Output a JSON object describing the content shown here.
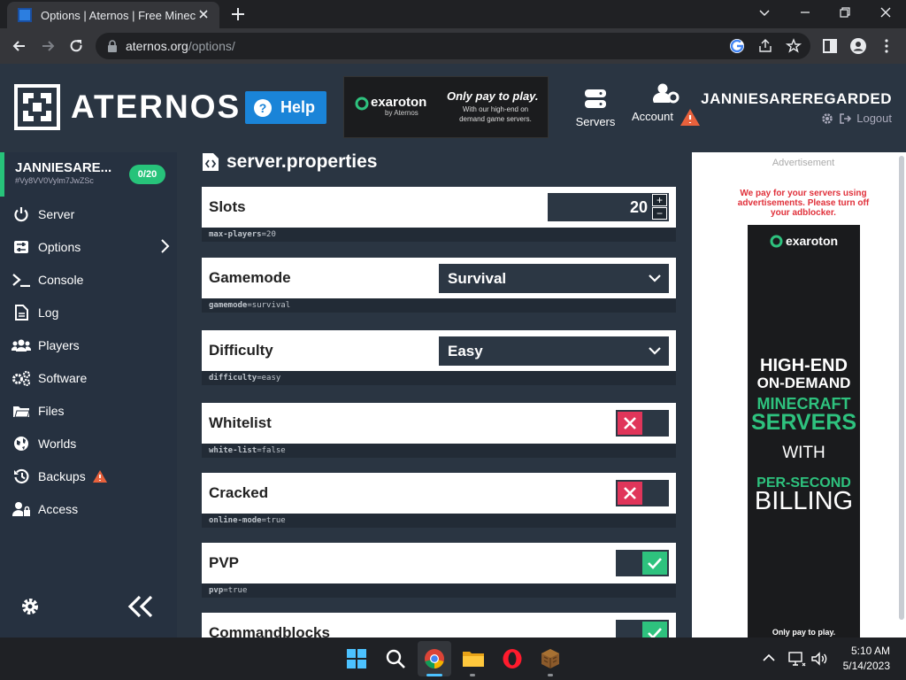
{
  "browser": {
    "tab_title": "Options | Aternos | Free Minecraft",
    "url_host": "aternos.org",
    "url_path": "/options/"
  },
  "header": {
    "brand": "ATERNOS",
    "help_label": "Help",
    "ad": {
      "logo_text": "exaroton",
      "logo_sub": "by Aternos",
      "headline": "Only pay to play.",
      "subline": "With our high-end on demand game servers."
    },
    "servers_label": "Servers",
    "account_label": "Account",
    "username": "JANNIESAREREGARDED",
    "logout_label": "Logout"
  },
  "sidebar": {
    "server_name": "JANNIESARE...",
    "server_id": "#Vy8VV0Vylm7JwZSc",
    "player_count": "0/20",
    "items": [
      {
        "label": "Server",
        "icon": "power-icon"
      },
      {
        "label": "Options",
        "icon": "sliders-icon"
      },
      {
        "label": "Console",
        "icon": "terminal-icon"
      },
      {
        "label": "Log",
        "icon": "file-icon"
      },
      {
        "label": "Players",
        "icon": "users-icon"
      },
      {
        "label": "Software",
        "icon": "gears-icon"
      },
      {
        "label": "Files",
        "icon": "folder-icon"
      },
      {
        "label": "Worlds",
        "icon": "globe-icon"
      },
      {
        "label": "Backups",
        "icon": "history-icon"
      },
      {
        "label": "Access",
        "icon": "user-lock-icon"
      }
    ]
  },
  "main": {
    "title": "server.properties",
    "options": [
      {
        "label": "Slots",
        "key": "max-players",
        "value": "20",
        "control": "number"
      },
      {
        "label": "Gamemode",
        "key": "gamemode",
        "value": "survival",
        "display": "Survival",
        "control": "select"
      },
      {
        "label": "Difficulty",
        "key": "difficulty",
        "value": "easy",
        "display": "Easy",
        "control": "select"
      },
      {
        "label": "Whitelist",
        "key": "white-list",
        "value": "false",
        "control": "toggle",
        "on": false
      },
      {
        "label": "Cracked",
        "key": "online-mode",
        "value": "true",
        "control": "toggle",
        "on": false
      },
      {
        "label": "PVP",
        "key": "pvp",
        "value": "true",
        "control": "toggle",
        "on": true
      },
      {
        "label": "Commandblocks",
        "control": "toggle",
        "on": true
      }
    ]
  },
  "right_ad": {
    "label": "Advertisement",
    "warning": "We pay for your servers using advertisements. Please turn off your adblocker.",
    "brand": "exaroton",
    "lines": [
      "HIGH-END",
      "ON-DEMAND",
      "MINECRAFT",
      "SERVERS",
      "WITH",
      "PER-SECOND",
      "BILLING"
    ],
    "footer": "Only pay to play."
  },
  "taskbar": {
    "time": "5:10 AM",
    "date": "5/14/2023"
  },
  "colors": {
    "accent_green": "#27c37a",
    "toggle_off": "#e0355a",
    "help_blue": "#1a84d8",
    "ad_warning": "#e0303a"
  }
}
